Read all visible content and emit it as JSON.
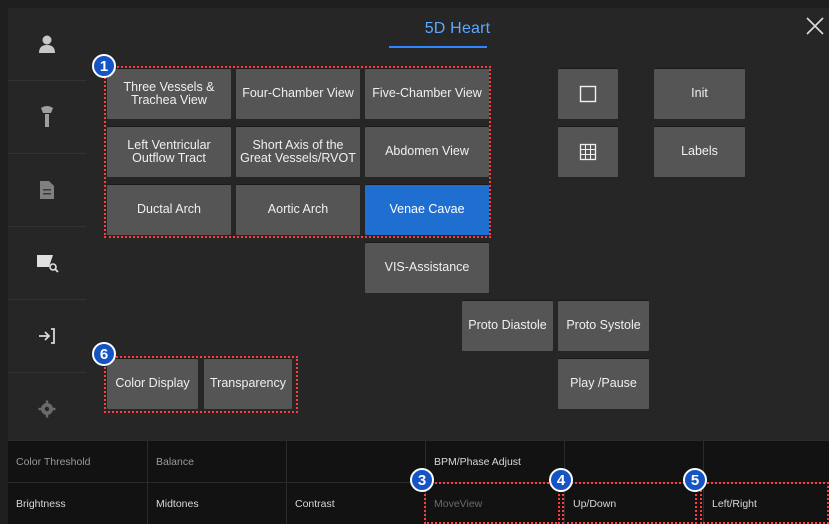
{
  "header": {
    "title": "5D Heart"
  },
  "views": [
    "Three Vessels &\nTrachea View",
    "Four-Chamber View",
    "Five-Chamber View",
    "Left Ventricular\nOutflow Tract",
    "Short Axis of the\nGreat Vessels/RVOT",
    "Abdomen View",
    "Ductal Arch",
    "Aortic Arch",
    "Venae Cavae"
  ],
  "assist_label": "VIS-Assistance",
  "right_buttons": {
    "init": "Init",
    "labels": "Labels"
  },
  "proto": {
    "diastole": "Proto Diastole",
    "systole": "Proto Systole",
    "play_pause": "Play /Pause"
  },
  "display": {
    "color_display": "Color Display",
    "transparency": "Transparency"
  },
  "badges": [
    "1",
    "3",
    "4",
    "5",
    "6"
  ],
  "bottom_row1": [
    "Color Threshold",
    "Balance",
    "",
    "BPM/Phase Adjust",
    "",
    ""
  ],
  "bottom_row2": [
    "Brightness",
    "Midtones",
    "Contrast",
    "MoveView",
    "Up/Down",
    "Left/Right"
  ],
  "colors": {
    "accent": "#1f6fd1",
    "highlight": "#ff3b3b",
    "badge": "#1554c5"
  },
  "sidebar_icons": [
    "user-icon",
    "probe-icon",
    "document-icon",
    "image-zoom-icon",
    "exit-icon",
    "gear-icon"
  ]
}
